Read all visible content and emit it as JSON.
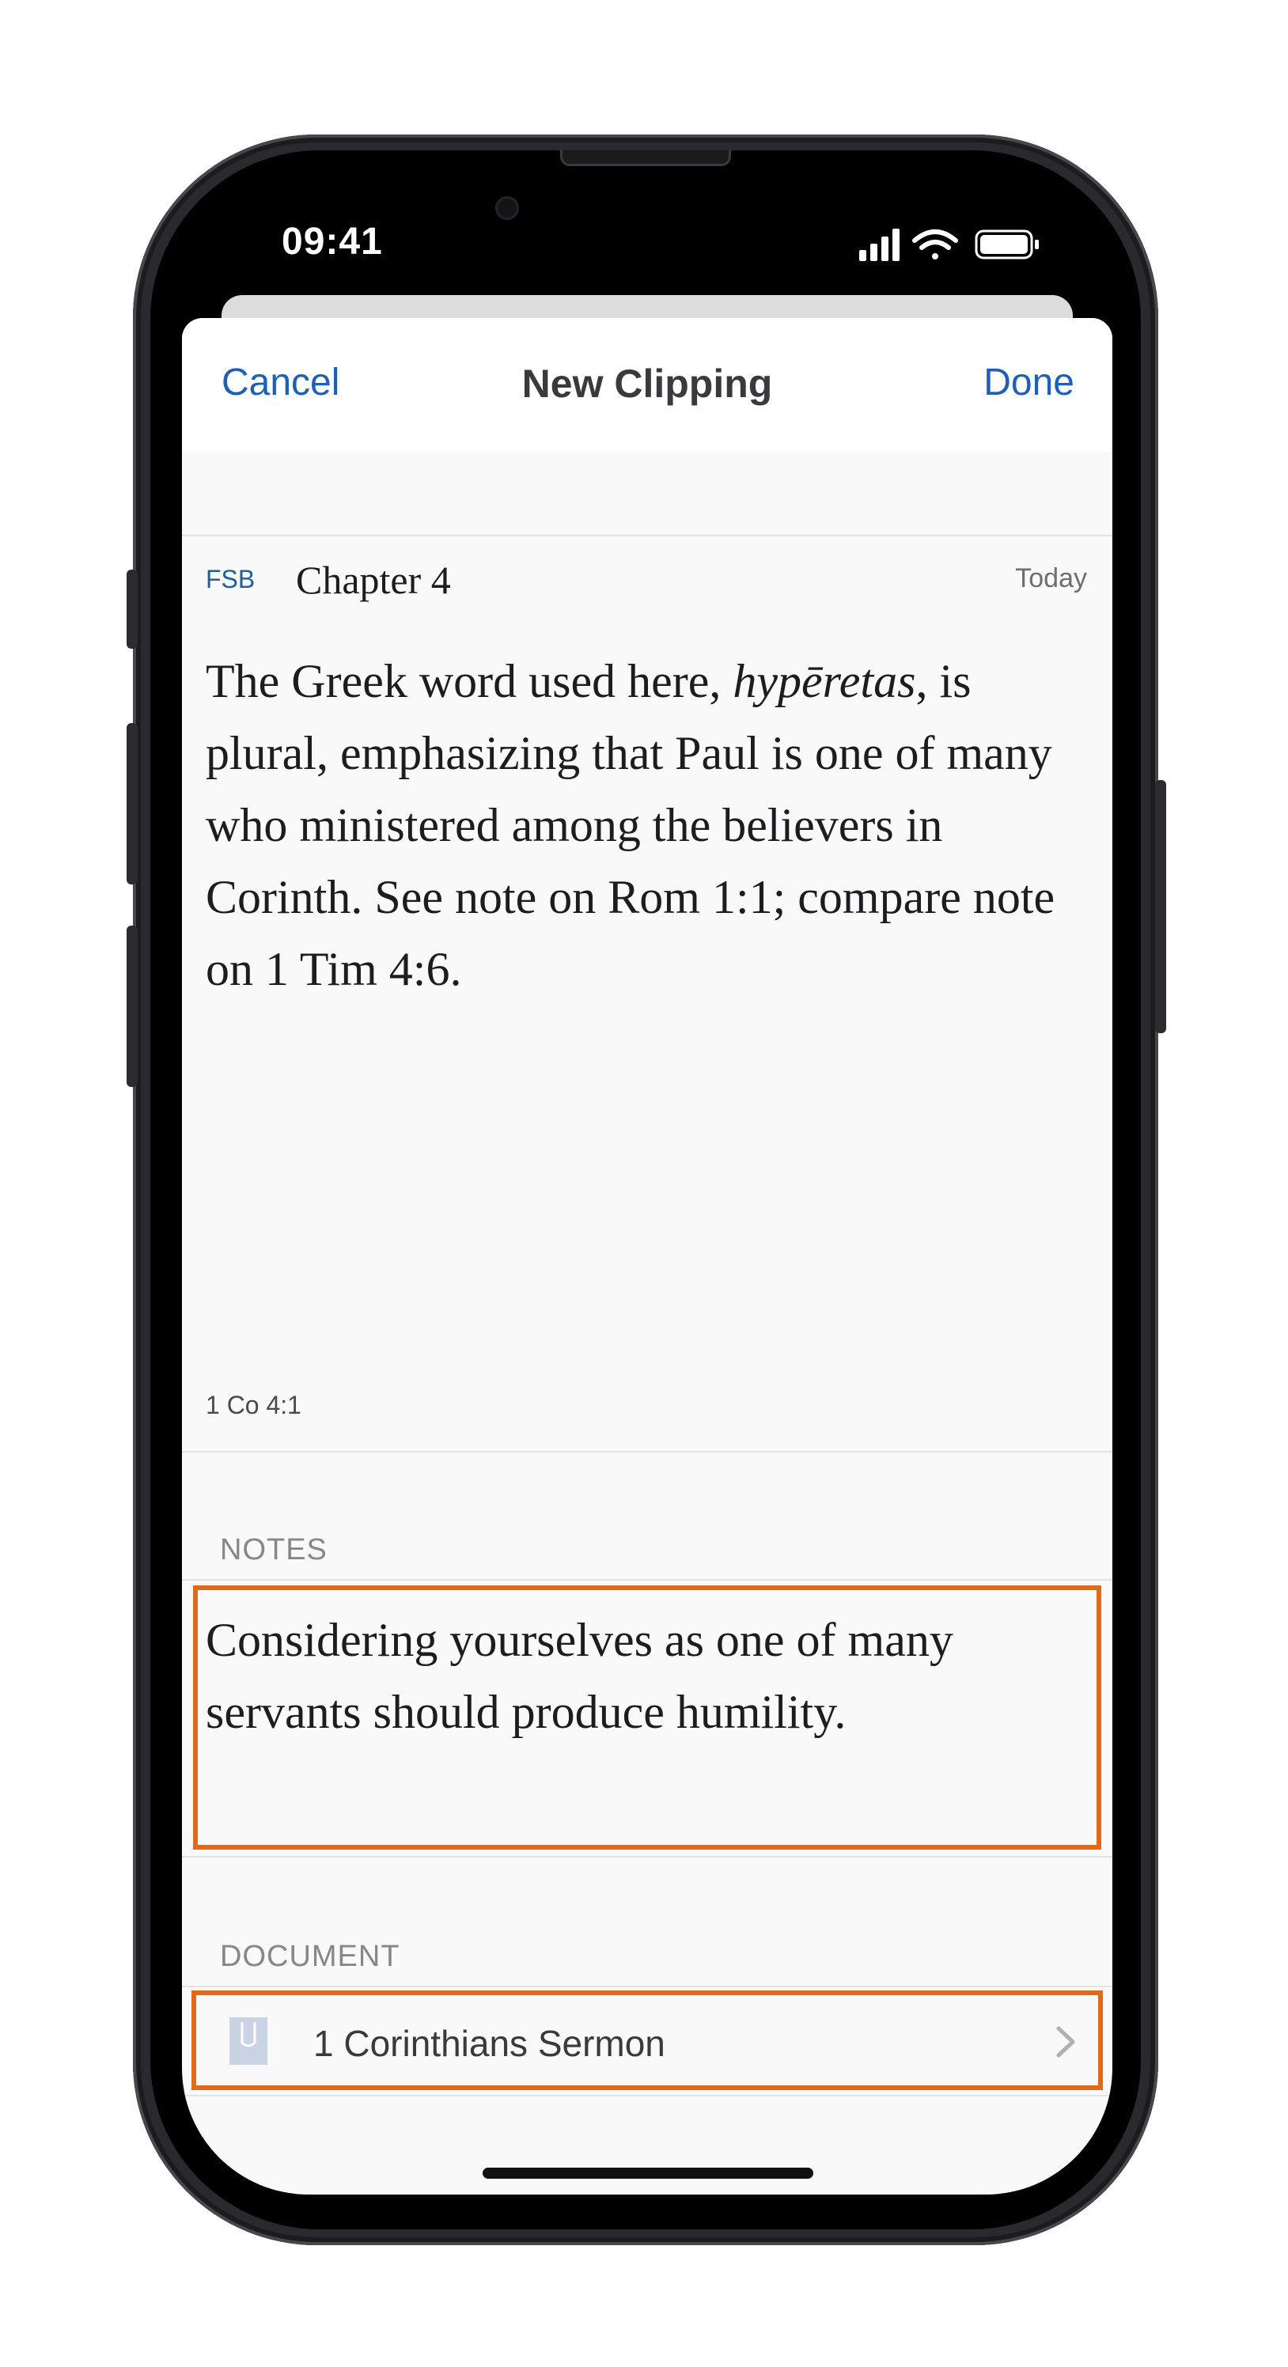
{
  "status_bar": {
    "time": "09:41",
    "icons": [
      "cellular-signal-icon",
      "wifi-icon",
      "battery-icon"
    ]
  },
  "nav": {
    "cancel_label": "Cancel",
    "title": "New Clipping",
    "done_label": "Done"
  },
  "clipping": {
    "source_abbr": "FSB",
    "chapter": "Chapter 4",
    "date": "Today",
    "quote_before": "The Greek word used here, ",
    "quote_italic": "hypēretas",
    "quote_after": ", is plural, emphasizing that Paul is one of many who ministered among the believers in Corinth. See note on Rom 1:1; compare note on 1 Tim 4:6.",
    "reference": "1 Co 4:1"
  },
  "notes": {
    "header": "NOTES",
    "text": "Considering yourselves as one of many servants should produce humility."
  },
  "document": {
    "header": "DOCUMENT",
    "name": "1 Corinthians Sermon",
    "icon": "document-icon"
  },
  "colors": {
    "accent": "#1f5fb8",
    "highlight_border": "#e0691a",
    "source_abbr": "#1f5f9a"
  }
}
